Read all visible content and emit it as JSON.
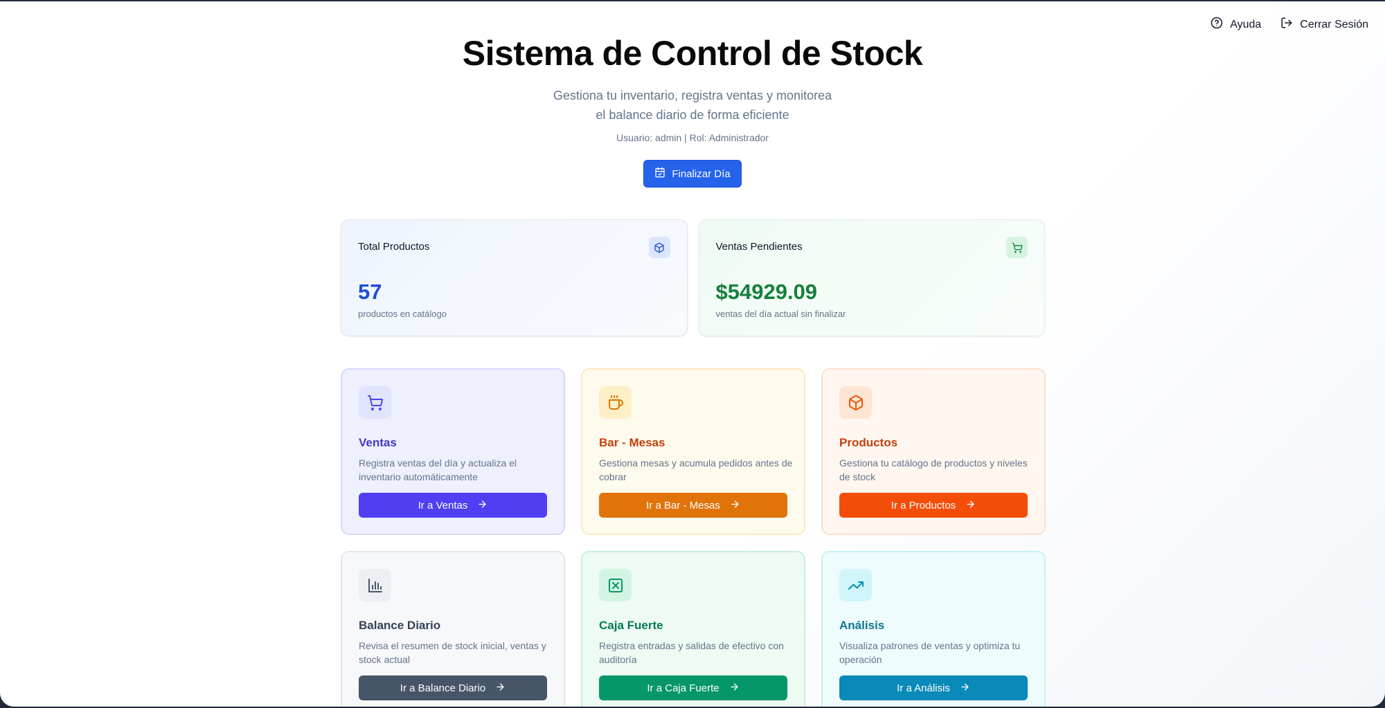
{
  "topbar": {
    "help": "Ayuda",
    "logout": "Cerrar Sesión"
  },
  "hero": {
    "title": "Sistema de Control de Stock",
    "subtitle": "Gestiona tu inventario, registra ventas y monitorea el balance diario de forma eficiente",
    "user_line": "Usuario: admin | Rol: Administrador",
    "finish_day": "Finalizar Día"
  },
  "stats": [
    {
      "label": "Total Productos",
      "value": "57",
      "sub": "productos en catálogo",
      "icon": "package-icon",
      "color": "#1d4ed8"
    },
    {
      "label": "Ventas Pendientes",
      "value": "$54929.09",
      "sub": "ventas del día actual sin finalizar",
      "icon": "cart-icon",
      "color": "#15803d"
    }
  ],
  "modules": [
    {
      "title": "Ventas",
      "desc": "Registra ventas del día y actualiza el inventario automáticamente",
      "button": "Ir a Ventas",
      "icon": "cart-icon"
    },
    {
      "title": "Bar - Mesas",
      "desc": "Gestiona mesas y acumula pedidos antes de cobrar",
      "button": "Ir a Bar - Mesas",
      "icon": "coffee-icon"
    },
    {
      "title": "Productos",
      "desc": "Gestiona tu catálogo de productos y niveles de stock",
      "button": "Ir a Productos",
      "icon": "package-icon"
    },
    {
      "title": "Balance Diario",
      "desc": "Revisa el resumen de stock inicial, ventas y stock actual",
      "button": "Ir a Balance Diario",
      "icon": "bar-chart-icon"
    },
    {
      "title": "Caja Fuerte",
      "desc": "Registra entradas y salidas de efectivo con auditoría",
      "button": "Ir a Caja Fuerte",
      "icon": "safe-icon"
    },
    {
      "title": "Análisis",
      "desc": "Visualiza patrones de ventas y optimiza tu operación",
      "button": "Ir a Análisis",
      "icon": "trending-up-icon"
    }
  ]
}
